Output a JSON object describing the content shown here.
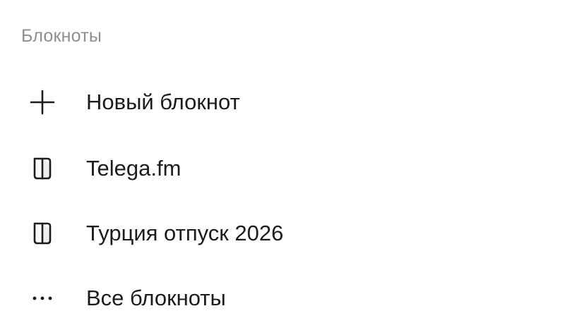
{
  "sidebar": {
    "section_title": "Блокноты",
    "items": [
      {
        "label": "Новый блокнот",
        "icon": "plus-icon"
      },
      {
        "label": "Telega.fm",
        "icon": "notebook-icon"
      },
      {
        "label": "Турция отпуск 2026",
        "icon": "notebook-icon"
      },
      {
        "label": "Все блокноты",
        "icon": "more-dots-icon"
      }
    ]
  },
  "colors": {
    "text": "#1c1c1c",
    "section_title": "#8e8e8e",
    "background": "#ffffff"
  }
}
